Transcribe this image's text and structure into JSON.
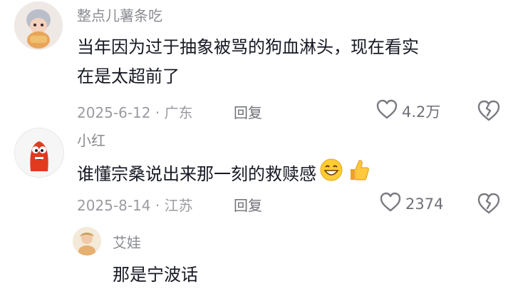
{
  "comments": [
    {
      "username": "整点儿薯条吃",
      "text_line1": "当年因为过于抽象被骂的狗血淋头，现在看实",
      "text_line2": "在是太超前了",
      "date_location": "2025-6-12 · 广东",
      "reply_label": "回复",
      "likes": "4.2万"
    },
    {
      "username": "小红",
      "text": "谁懂宗桑说出来那一刻的救赎感",
      "date_location": "2025-8-14 · 江苏",
      "reply_label": "回复",
      "likes": "2374"
    }
  ],
  "subreply": {
    "username": "艾娃",
    "text": "那是宁波话"
  },
  "icons": {
    "like": "heart-outline-icon",
    "dislike": "broken-heart-icon",
    "emoji_1": "grinning-face-emoji",
    "emoji_2": "thumbs-up-emoji"
  }
}
